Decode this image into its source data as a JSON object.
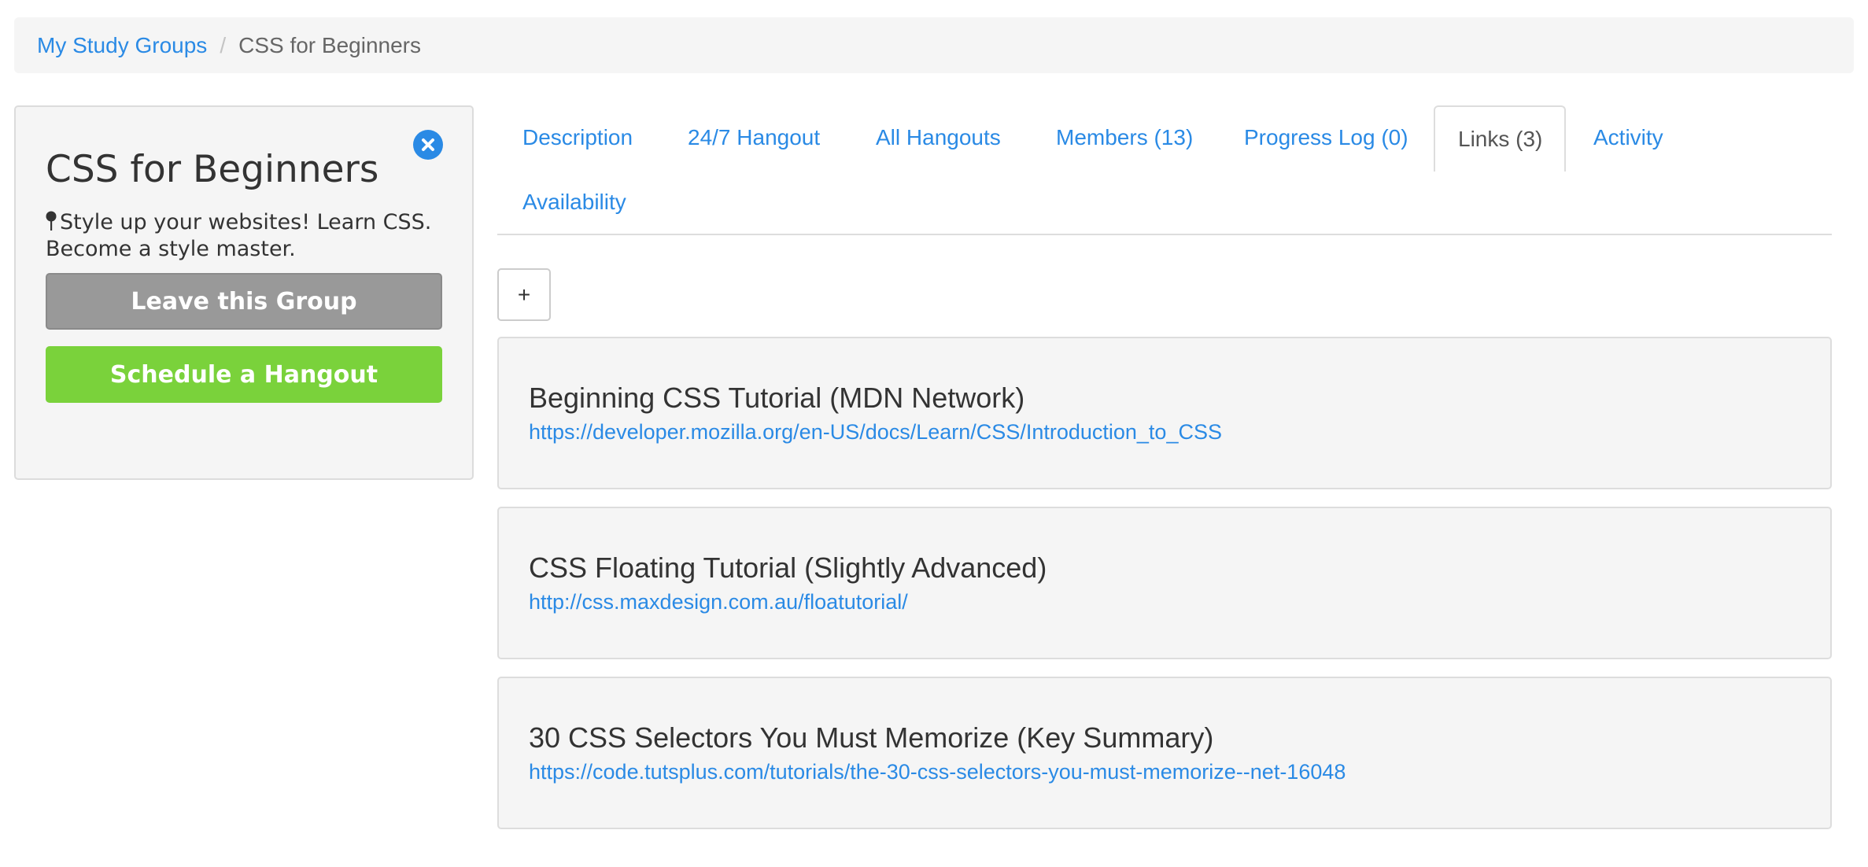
{
  "breadcrumb": {
    "parent": "My Study Groups",
    "separator": "/",
    "current": "CSS for Beginners"
  },
  "group": {
    "title": "CSS for Beginners",
    "description": "Style up your websites! Learn CSS. Become a style master.",
    "leave_label": "Leave this Group",
    "schedule_label": "Schedule a Hangout"
  },
  "tabs": [
    {
      "label": "Description"
    },
    {
      "label": "24/7 Hangout"
    },
    {
      "label": "All Hangouts"
    },
    {
      "label": "Members (13)"
    },
    {
      "label": "Progress Log (0)"
    },
    {
      "label": "Links (3)",
      "active": true
    },
    {
      "label": "Activity"
    },
    {
      "label": "Availability"
    }
  ],
  "add_label": "+",
  "links": [
    {
      "title": "Beginning CSS Tutorial (MDN Network)",
      "url": "https://developer.mozilla.org/en-US/docs/Learn/CSS/Introduction_to_CSS"
    },
    {
      "title": "CSS Floating Tutorial (Slightly Advanced)",
      "url": "http://css.maxdesign.com.au/floatutorial/"
    },
    {
      "title": "30 CSS Selectors You Must Memorize (Key Summary)",
      "url": "https://code.tutsplus.com/tutorials/the-30-css-selectors-you-must-memorize--net-16048"
    }
  ],
  "colors": {
    "link": "#2a8ae5",
    "leave_button": "#999999",
    "schedule_button": "#7ad23b",
    "close_icon": "#2a8ae5"
  },
  "icons": {
    "close": "close-circle-icon",
    "location": "map-pin-icon"
  }
}
